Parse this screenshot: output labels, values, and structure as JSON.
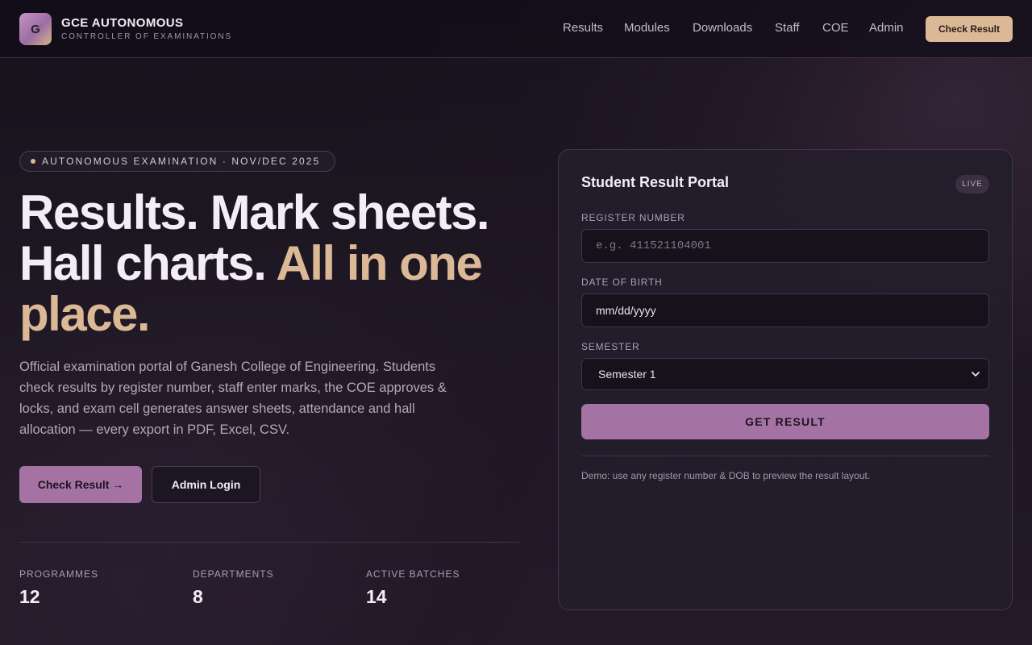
{
  "header": {
    "logo_letter": "G",
    "brand_title": "GCE AUTONOMOUS",
    "brand_subtitle": "CONTROLLER OF EXAMINATIONS",
    "nav": [
      "Results",
      "Modules",
      "Downloads",
      "Staff",
      "COE",
      "Admin"
    ],
    "cta_label": "Check Result"
  },
  "hero": {
    "pill_text": "AUTONOMOUS EXAMINATION · NOV/DEC 2025",
    "headline_line1": "Results. Mark sheets.",
    "headline_line2_plain": "Hall charts.",
    "headline_line2_accent": "All in one",
    "headline_line3_accent": "place.",
    "lede": "Official examination portal of Ganesh College of Engineering. Students check results by register number, staff enter marks, the COE approves & locks, and exam cell generates answer sheets, attendance and hall allocation — every export in PDF, Excel, CSV.",
    "primary_button": "Check Result →",
    "secondary_button": "Admin Login",
    "stats": [
      {
        "label": "PROGRAMMES",
        "value": "12"
      },
      {
        "label": "DEPARTMENTS",
        "value": "8"
      },
      {
        "label": "ACTIVE BATCHES",
        "value": "14"
      }
    ]
  },
  "portal": {
    "title": "Student Result Portal",
    "badge": "LIVE",
    "register_label": "REGISTER NUMBER",
    "register_placeholder": "e.g. 411521104001",
    "dob_label": "DATE OF BIRTH",
    "dob_value": "mm/dd/yyyy",
    "semester_label": "SEMESTER",
    "semester_value": "Semester 1",
    "submit_label": "GET RESULT",
    "note": "Demo: use any register number & DOB to preview the result layout."
  },
  "colors": {
    "accent": "#dcb996",
    "primary": "#a473a3",
    "background": "#1a1520"
  }
}
